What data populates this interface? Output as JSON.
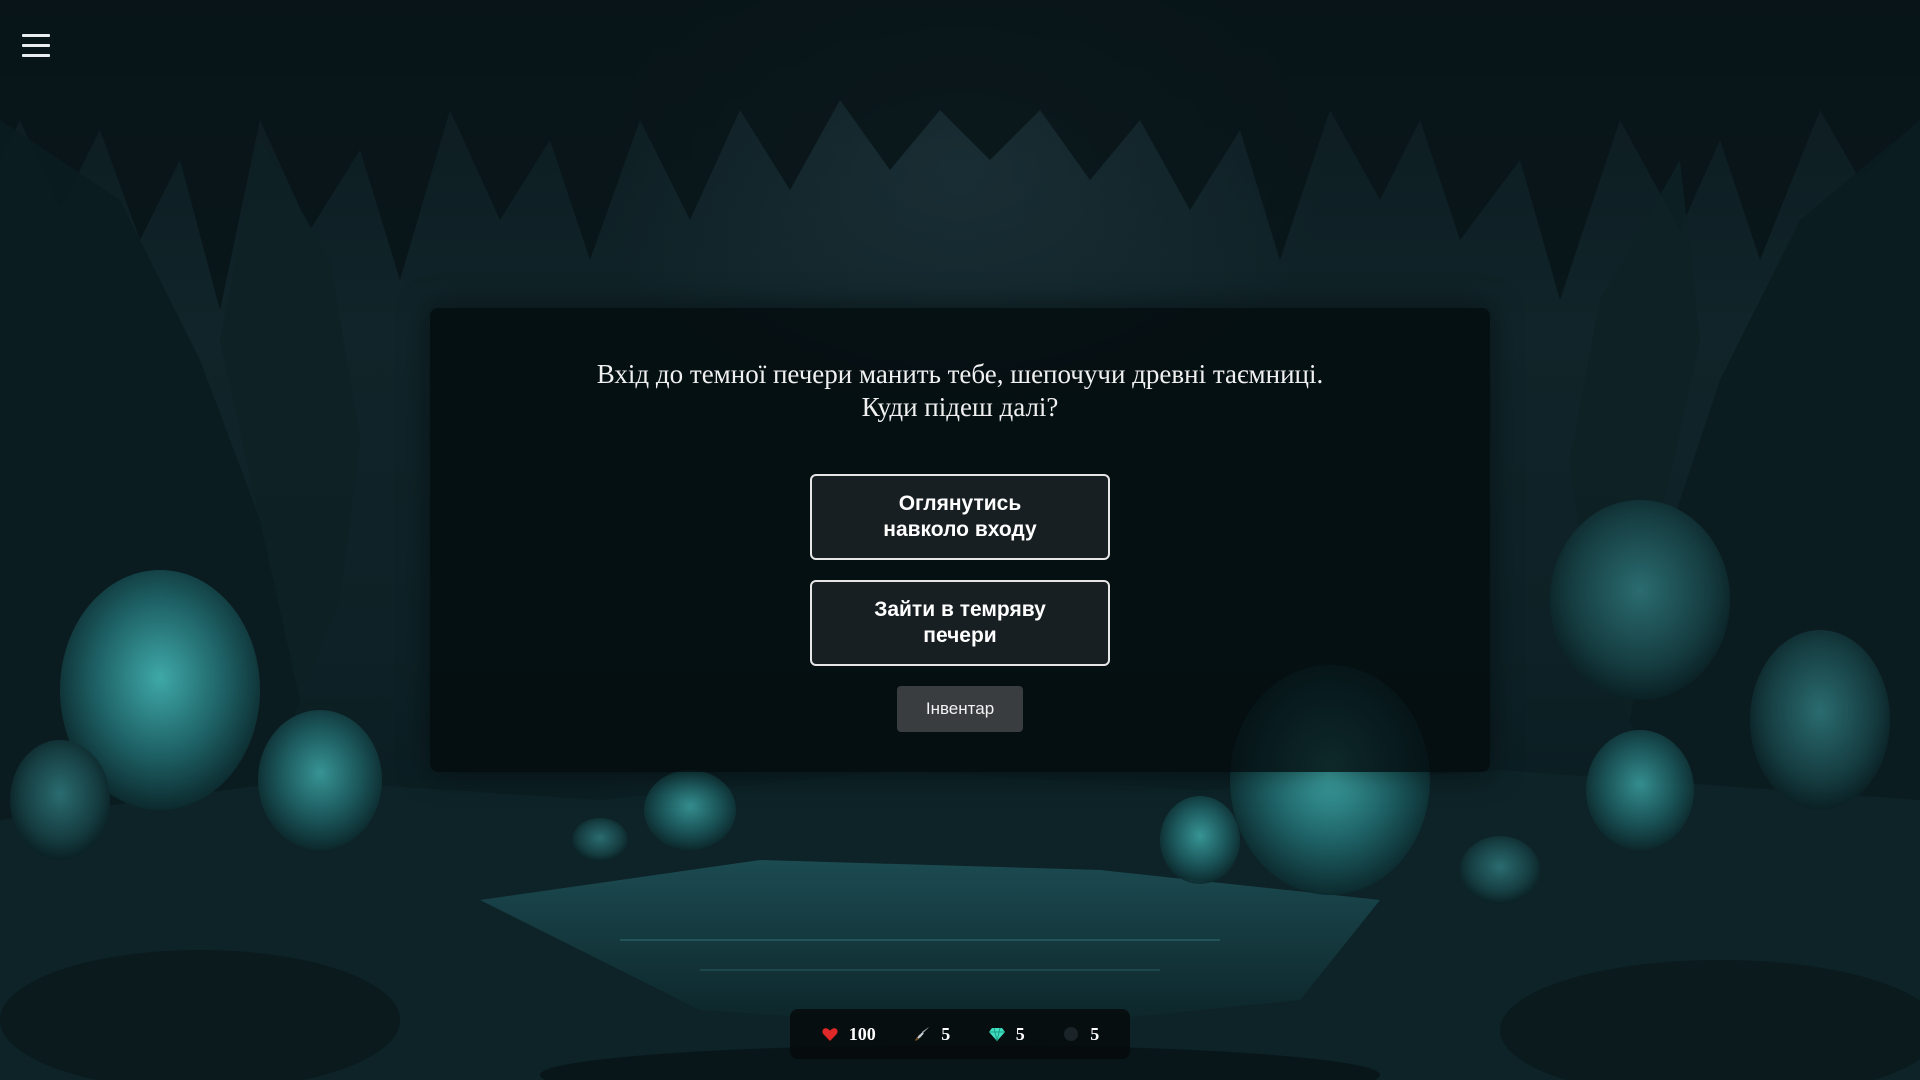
{
  "hud": {
    "menu_icon": "hamburger-menu-icon"
  },
  "dialog": {
    "story_line_1": "Вхід до темної печери манить тебе, шепочучи древні таємниці.",
    "story_line_2": "Куди підеш далі?",
    "choices": [
      {
        "label_line_1": "Оглянутись",
        "label_line_2": "навколо входу"
      },
      {
        "label_line_1": "Зайти в темряву",
        "label_line_2": "печери"
      }
    ],
    "inventory_label": "Інвентар"
  },
  "stats": [
    {
      "icon": "heart-icon",
      "value": "100",
      "color": "#e02828"
    },
    {
      "icon": "sword-icon",
      "value": "5",
      "color": "#b8c4cc"
    },
    {
      "icon": "gem-icon",
      "value": "5",
      "color": "#3fe0c0"
    },
    {
      "icon": "shadow-icon",
      "value": "5",
      "color": "#1a2428"
    }
  ]
}
